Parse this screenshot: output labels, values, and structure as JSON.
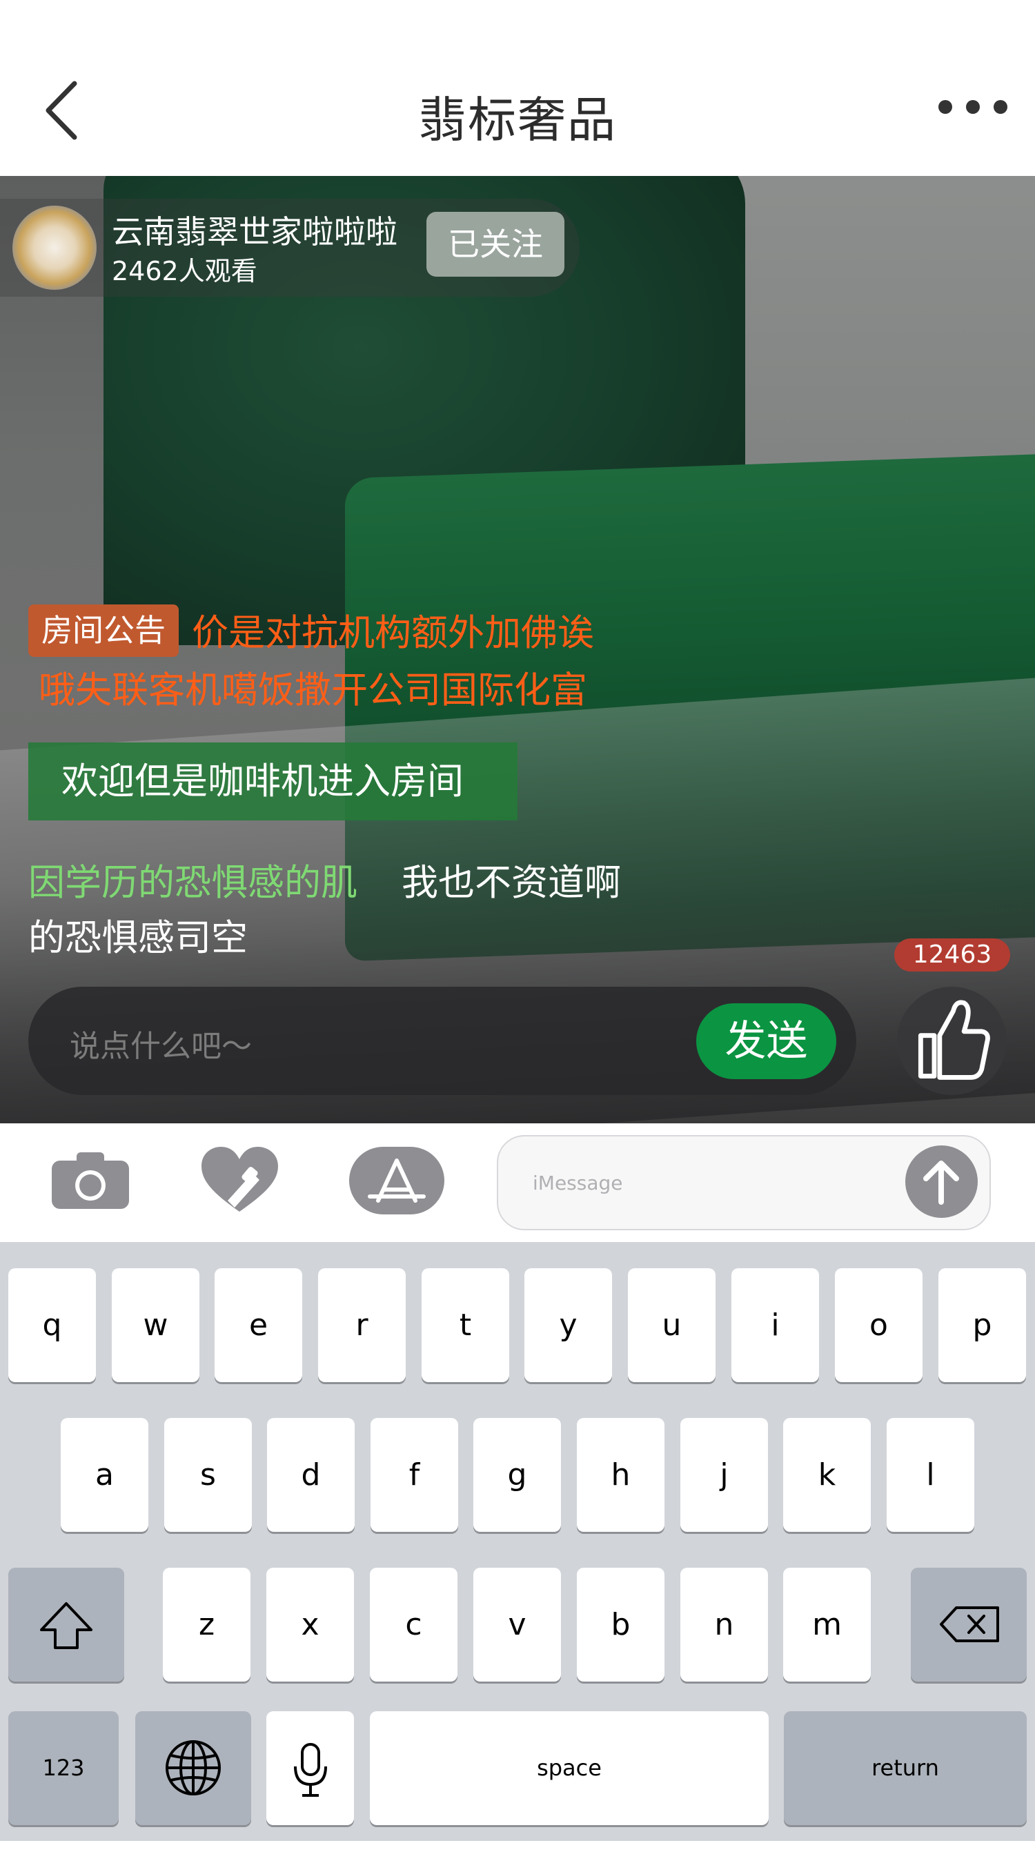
{
  "header": {
    "title": "翡标奢品"
  },
  "streamer": {
    "name": "云南翡翠世家啦啦啦",
    "viewers": "2462人观看",
    "follow_label": "已关注"
  },
  "notice": {
    "badge": "房间公告",
    "line1": "价是对抗机构额外加佛诶",
    "line2": "哦失联客机噶饭撒开公司国际化富"
  },
  "welcome": {
    "text": "欢迎但是咖啡机进入房间"
  },
  "message": {
    "user": "因学历的恐惧感的肌",
    "text_line1": "我也不资道啊",
    "text_line2": "的恐惧感司空"
  },
  "likes": {
    "count": "12463"
  },
  "chat_input": {
    "placeholder": "说点什么吧～",
    "send_label": "发送"
  },
  "imessage": {
    "placeholder": "iMessage"
  },
  "keyboard": {
    "row1": [
      "q",
      "w",
      "e",
      "r",
      "t",
      "y",
      "u",
      "i",
      "o",
      "p"
    ],
    "row2": [
      "a",
      "s",
      "d",
      "f",
      "g",
      "h",
      "j",
      "k",
      "l"
    ],
    "row3": [
      "z",
      "x",
      "c",
      "v",
      "b",
      "n",
      "m"
    ],
    "numbers": "123",
    "space": "space",
    "return": "return"
  },
  "colors": {
    "notice_badge": "#c1592f",
    "notice_text": "#ff5e17",
    "welcome_bg": "#247a38",
    "username": "#7fd973",
    "send_button": "#0b9442",
    "like_badge": "#b23c31",
    "follow_button": "#9aa59e"
  }
}
